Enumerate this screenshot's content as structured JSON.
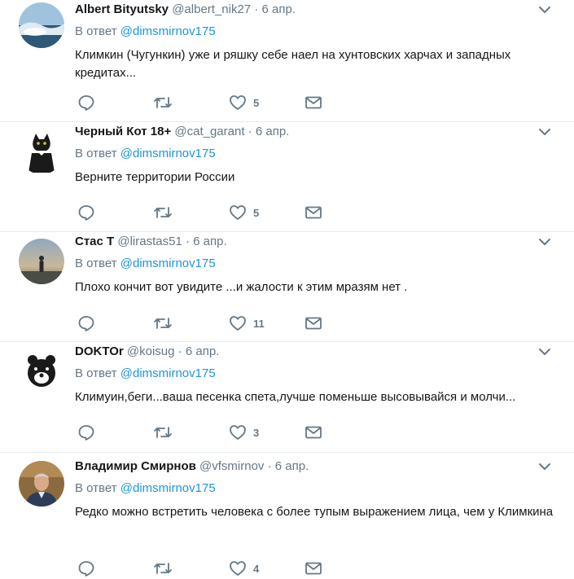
{
  "tweets": [
    {
      "name": "Albert Bityutsky",
      "handle": "@albert_nik27",
      "dot": "·",
      "time": "6 апр.",
      "reply_prefix": "В ответ",
      "reply_mention": "@dimsmirnov175",
      "text": "Климкин (Чугункин) уже и ряшку себе наел на хунтовских харчах и западных кредитах...",
      "likes": "5",
      "avatar_icon": "landscape-photo"
    },
    {
      "name": "Черный Кот 18+",
      "handle": "@cat_garant",
      "dot": "·",
      "time": "6 апр.",
      "reply_prefix": "В ответ",
      "reply_mention": "@dimsmirnov175",
      "text": "Верните территории России",
      "likes": "5",
      "avatar_icon": "black-cat"
    },
    {
      "name": "Стас Т",
      "handle": "@lirastas51",
      "dot": "·",
      "time": "6 апр.",
      "reply_prefix": "В ответ",
      "reply_mention": "@dimsmirnov175",
      "text": "Плохо кончит вот увидите ...и жалости к этим мразям нет .",
      "likes": "11",
      "avatar_icon": "person-at-sunset"
    },
    {
      "name": "DOKTOr",
      "handle": "@koisug",
      "dot": "·",
      "time": "6 апр.",
      "reply_prefix": "В ответ",
      "reply_mention": "@dimsmirnov175",
      "text": "Климуин,беги...ваша песенка спета,лучше поменьше высовывайся и молчи...",
      "likes": "3",
      "avatar_icon": "bear-logo"
    },
    {
      "name": "Владимир Смирнов",
      "handle": "@vfsmirnov",
      "dot": "·",
      "time": "6 апр.",
      "reply_prefix": "В ответ",
      "reply_mention": "@dimsmirnov175",
      "text": "Редко можно встретить человека с более тупым выражением лица, чем у Климкина",
      "likes": "4",
      "avatar_icon": "man-portrait"
    }
  ],
  "colors": {
    "link": "#1b95e0",
    "muted": "#657786",
    "text": "#14171a",
    "divider": "#e6ecf0"
  }
}
